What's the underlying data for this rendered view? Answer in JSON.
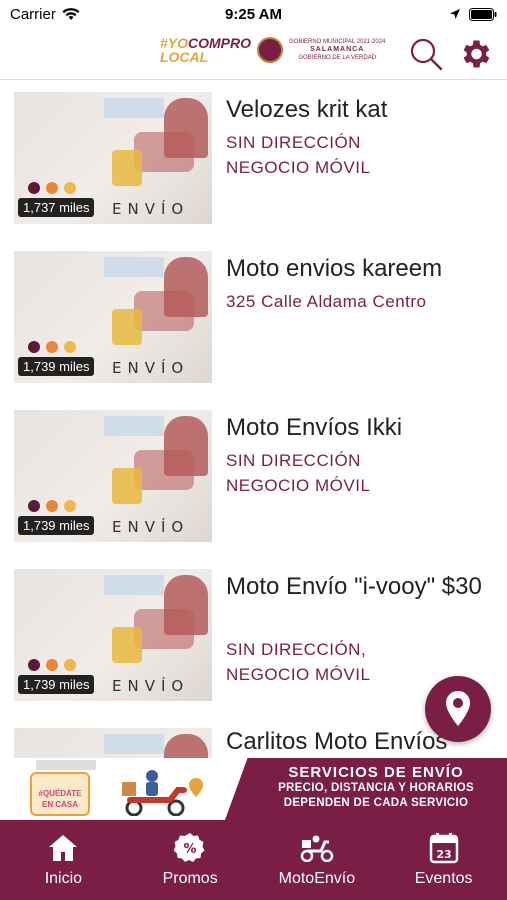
{
  "status_bar": {
    "carrier": "Carrier",
    "time": "9:25 AM"
  },
  "header": {
    "logo_line1_a": "#YO",
    "logo_line1_b": "COMPRO",
    "logo_line2": "LOCAL",
    "municipality_small": "GOBIERNO MUNICIPAL 2021-2024",
    "municipality_name": "SALAMANCA",
    "municipality_tagline": "GOBIERNO DE LA VERDAD"
  },
  "items": [
    {
      "title": "Velozes krit kat",
      "distance": "1,737 miles",
      "envio_label": "ENVÍO",
      "address_lines": [
        "SIN DIRECCIÓN",
        "NEGOCIO MÓVIL"
      ]
    },
    {
      "title": "Moto envios kareem",
      "distance": "1,739 miles",
      "envio_label": "ENVÍO",
      "address_lines": [
        "325 Calle Aldama Centro"
      ]
    },
    {
      "title": "Moto Envíos Ikki",
      "distance": "1,739 miles",
      "envio_label": "ENVÍO",
      "address_lines": [
        "SIN DIRECCIÓN",
        "NEGOCIO MÓVIL"
      ]
    },
    {
      "title": "Moto Envío \"i-vooy\" $30",
      "distance": "1,739 miles",
      "envio_label": "ENVÍO",
      "address_lines": [
        "SIN DIRECCIÓN,",
        "NEGOCIO MÓVIL"
      ]
    },
    {
      "title": "Carlitos Moto Envíos",
      "distance": "",
      "envio_label": "",
      "address_lines": []
    }
  ],
  "banner": {
    "stay_home": "#QUÉDATE EN CASA",
    "title": "SERVICIOS DE ENVÍO",
    "line1": "PRECIO, DISTANCIA Y HORARIOS",
    "line2": "DEPENDEN DE CADA SERVICIO"
  },
  "tabs": [
    {
      "label": "Inicio",
      "icon": "home-icon"
    },
    {
      "label": "Promos",
      "icon": "percent-badge-icon"
    },
    {
      "label": "MotoEnvío",
      "icon": "scooter-icon"
    },
    {
      "label": "Eventos",
      "icon": "calendar-icon",
      "calendar_day": "23"
    }
  ],
  "colors": {
    "brand": "#7b1e45",
    "accent_orange": "#e8a23a",
    "dot_1": "#5a1a38",
    "dot_2": "#e8873a",
    "dot_3": "#f0b84a"
  }
}
